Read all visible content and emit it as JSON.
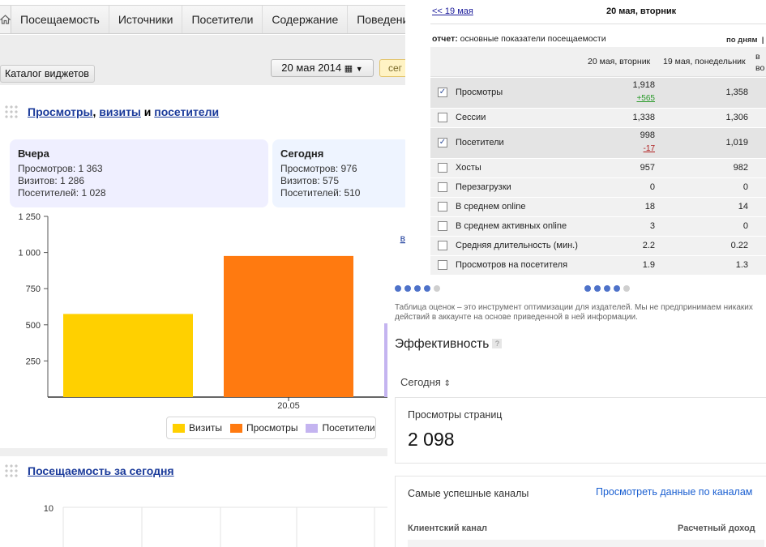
{
  "nav": {
    "home_icon": "home-icon",
    "tabs": [
      "Посещаемость",
      "Источники",
      "Посетители",
      "Содержание",
      "Поведение"
    ]
  },
  "toolbar": {
    "widgets_catalog": "Каталог виджетов",
    "date": "20 мая 2014",
    "segment_label": "сег"
  },
  "widget1": {
    "title_parts": [
      "Просмотры",
      "визиты",
      "посетители"
    ],
    "sep_comma": ",",
    "sep_and": "и",
    "yesterday": {
      "title": "Вчера",
      "lines": [
        "Просмотров: 1 363",
        "Визитов: 1 286",
        "Посетителей: 1 028"
      ]
    },
    "today": {
      "title": "Сегодня",
      "lines": [
        "Просмотров: 976",
        "Визитов: 575",
        "Посетителей: 510"
      ]
    },
    "side_link": "в"
  },
  "chart_data": {
    "type": "bar",
    "categories": [
      "20.05"
    ],
    "series": [
      {
        "name": "Визиты",
        "values": [
          575
        ],
        "color": "#ffd000"
      },
      {
        "name": "Просмотры",
        "values": [
          976
        ],
        "color": "#ff7a10"
      },
      {
        "name": "Посетители",
        "values": [
          510
        ],
        "color": "#c4b4f0"
      }
    ],
    "yticks": [
      "250",
      "500",
      "750",
      "1 000",
      "1 250"
    ],
    "ytick_values": [
      250,
      500,
      750,
      1000,
      1250
    ],
    "ylim": [
      0,
      1250
    ],
    "legend_position": "bottom-right",
    "grid": false
  },
  "widget2": {
    "title": "Посещаемость за сегодня",
    "ytick": "10"
  },
  "report": {
    "prev_link": "<< 19 мая",
    "current_date": "20 мая, вторник",
    "label": "отчет:",
    "name": "основные показатели посещаемости",
    "by_days": "по дням",
    "col1": "20 мая, вторник",
    "col2": "19 мая, понедельник",
    "col3": "в во",
    "rows": [
      {
        "name": "Просмотры",
        "v1": "1,918",
        "delta": "+565",
        "delta_color": "#2a9a2a",
        "v2": "1,358",
        "checked": true
      },
      {
        "name": "Сессии",
        "v1": "1,338",
        "delta": "",
        "delta_color": "",
        "v2": "1,306",
        "checked": false
      },
      {
        "name": "Посетители",
        "v1": "998",
        "delta": "-17",
        "delta_color": "#b02020",
        "v2": "1,019",
        "checked": true
      },
      {
        "name": "Хосты",
        "v1": "957",
        "delta": "",
        "delta_color": "",
        "v2": "982",
        "checked": false
      },
      {
        "name": "Перезагрузки",
        "v1": "0",
        "delta": "",
        "delta_color": "",
        "v2": "0",
        "checked": false
      },
      {
        "name": "В среднем online",
        "v1": "18",
        "delta": "",
        "delta_color": "",
        "v2": "14",
        "checked": false
      },
      {
        "name": "В среднем активных online",
        "v1": "3",
        "delta": "",
        "delta_color": "",
        "v2": "0",
        "checked": false
      },
      {
        "name": "Средняя длительность (мин.)",
        "v1": "2.2",
        "delta": "",
        "delta_color": "",
        "v2": "0.22",
        "checked": false
      },
      {
        "name": "Просмотров на посетителя",
        "v1": "1.9",
        "delta": "",
        "delta_color": "",
        "v2": "1.3",
        "checked": false
      }
    ]
  },
  "adsense": {
    "note": "Таблица оценок – это инструмент оптимизации для издателей. Мы не предпринимаем никаких действий в аккаунте на основе приведенной в ней информации.",
    "effectiveness": "Эффективность",
    "help": "?",
    "period": "Сегодня",
    "pageviews_label": "Просмотры страниц",
    "pageviews_value": "2 098",
    "channels_label": "Самые успешные каналы",
    "channels_link": "Просмотреть данные по каналам",
    "col_channel": "Клиентский канал",
    "col_revenue": "Расчетный доход"
  }
}
